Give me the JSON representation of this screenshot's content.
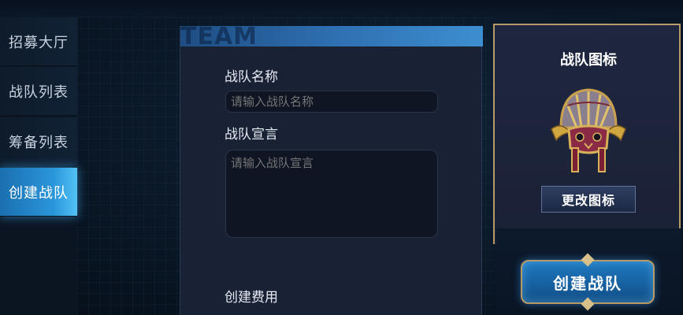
{
  "sidebar": {
    "items": [
      {
        "label": "招募大厅",
        "active": false
      },
      {
        "label": "战队列表",
        "active": false
      },
      {
        "label": "筹备列表",
        "active": false
      },
      {
        "label": "创建战队",
        "active": true
      }
    ]
  },
  "form": {
    "header_text": "TEAM",
    "name_label": "战队名称",
    "name_placeholder": "请输入战队名称",
    "declaration_label": "战队宣言",
    "declaration_placeholder": "请输入战队宣言",
    "fee_label": "创建费用"
  },
  "emblem": {
    "title": "战队图标",
    "icon": "team-emblem-icon",
    "change_button": "更改图标"
  },
  "create_button": "创建战队",
  "colors": {
    "accent_blue": "#2a97da",
    "gold_border": "#b89a68",
    "panel_bg": "#192235"
  }
}
